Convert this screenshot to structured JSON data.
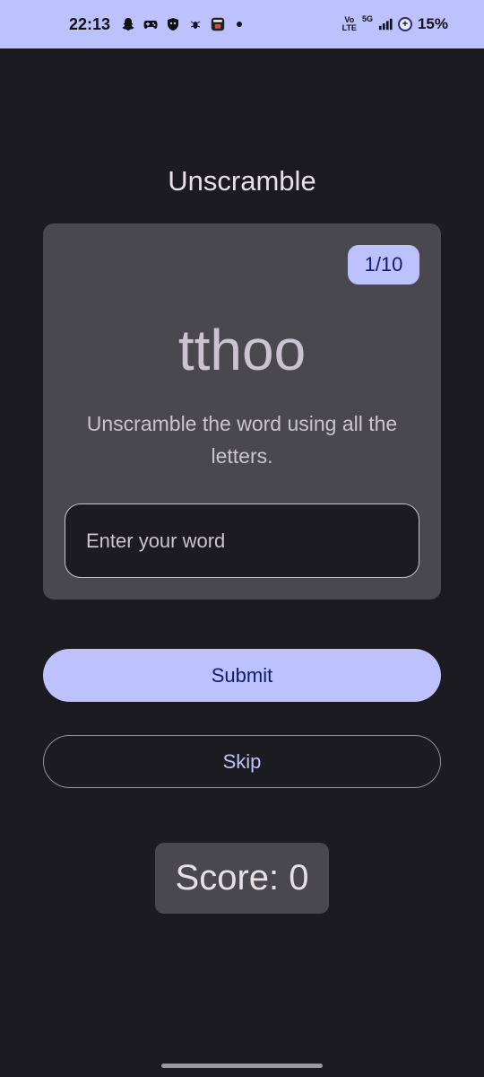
{
  "status_bar": {
    "time": "22:13",
    "icons_left": [
      "snapchat-icon",
      "gamepad-icon",
      "shield-face-icon",
      "bug-icon",
      "tv-app-icon"
    ],
    "volte": "Vo\nLTE",
    "network": "5G",
    "battery_percent": "15%"
  },
  "app": {
    "title": "Unscramble"
  },
  "game": {
    "counter": "1/10",
    "scrambled_word": "tthoo",
    "instructions": "Unscramble the word using all the letters.",
    "input_placeholder": "Enter your word",
    "input_value": ""
  },
  "actions": {
    "submit_label": "Submit",
    "skip_label": "Skip"
  },
  "score": {
    "label": "Score: 0"
  },
  "colors": {
    "background": "#1c1b1f",
    "status_bar": "#bdc2ff",
    "card": "#49484f",
    "primary": "#bdc2ff",
    "on_primary": "#121a6b"
  }
}
